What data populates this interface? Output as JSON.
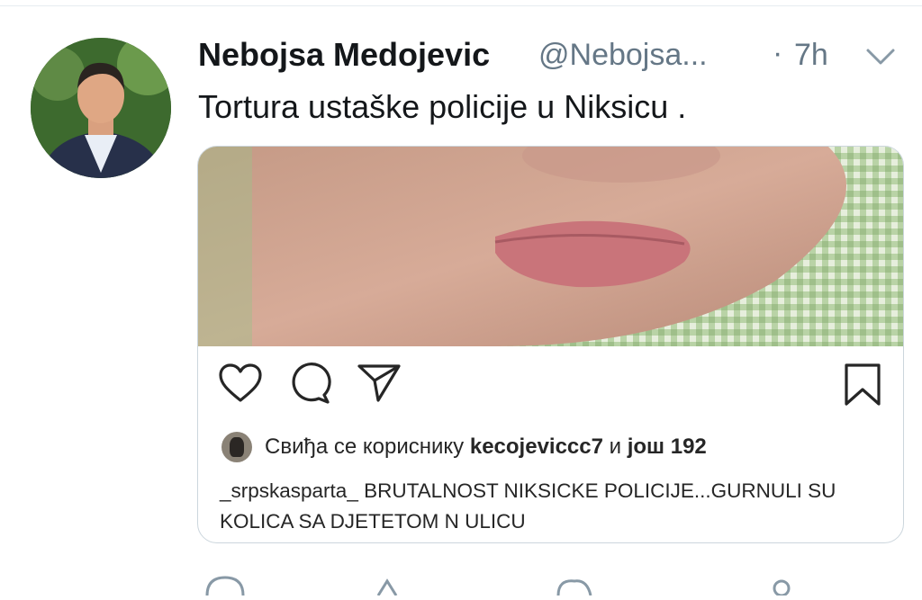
{
  "tweet": {
    "author_name": "Nebojsa Medojevic",
    "author_handle": "@Nebojsa...",
    "separator": "·",
    "time": "7h",
    "text": "Tortura ustaške policije u Niksicu ."
  },
  "embedded_post": {
    "likes_prefix": "Свиђа се кориснику ",
    "likes_user": "kecojeviccc7",
    "likes_joiner": " и ",
    "likes_suffix": "још 192",
    "caption_user": "_srpskasparta_",
    "caption_text": " BRUTALNOST NIKSICKE POLICIJE...GURNULI SU KOLICA SA DJETETOM N  ULICU"
  },
  "icons": [
    "avatar",
    "chevron-down-icon",
    "heart-icon",
    "comment-icon",
    "share-icon",
    "bookmark-icon"
  ],
  "colors": {
    "text": "#14171a",
    "muted": "#657786",
    "border": "#ccd6dd"
  }
}
